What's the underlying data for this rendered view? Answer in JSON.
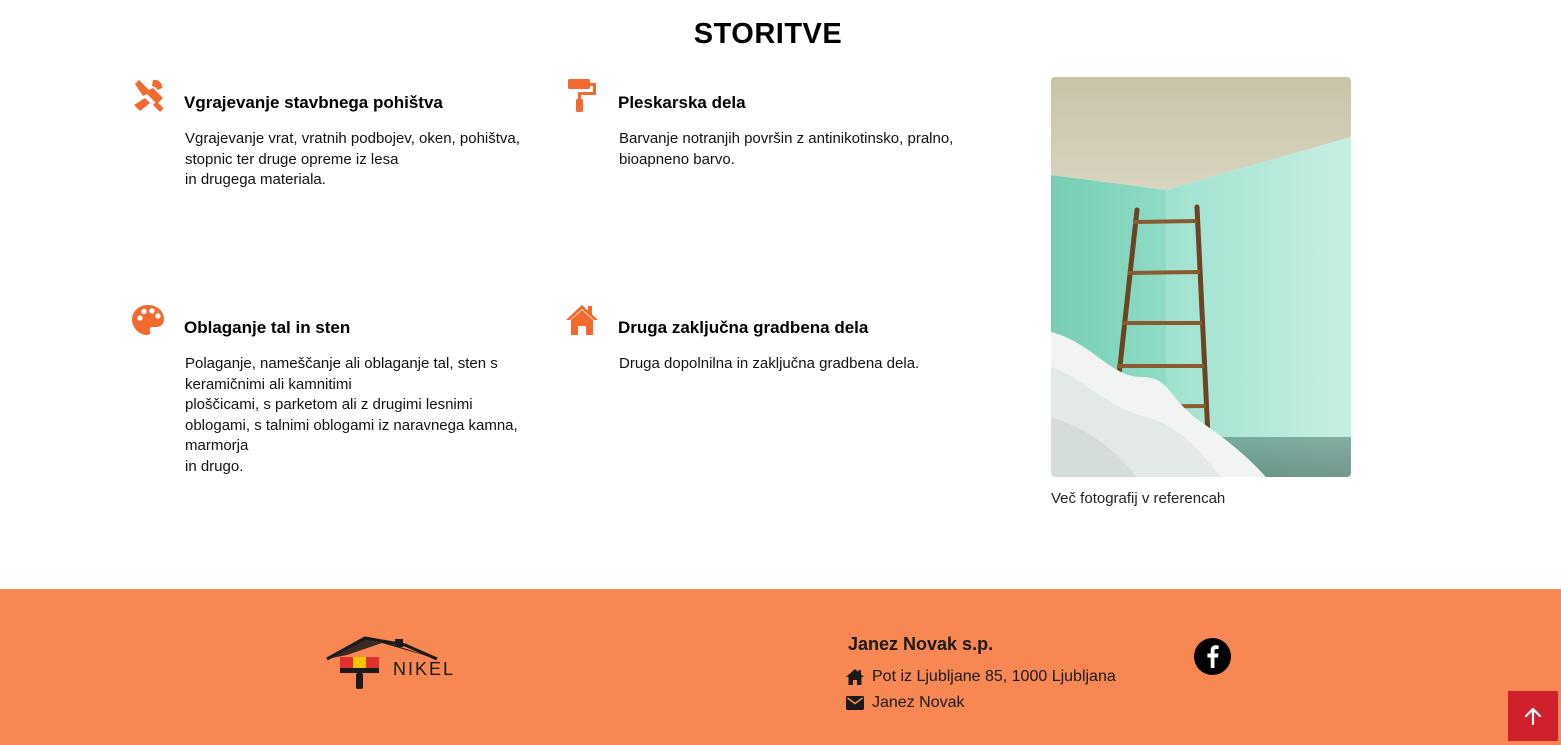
{
  "page": {
    "title": "STORITVE"
  },
  "services": [
    {
      "icon": "tools-icon",
      "title": "Vgrajevanje stavbnega pohištva",
      "lines": [
        "Vgrajevanje vrat, vratnih podbojev, oken, pohištva,",
        "stopnic ter druge opreme iz lesa",
        "in drugega materiala."
      ]
    },
    {
      "icon": "paint-roller-icon",
      "title": "Pleskarska dela",
      "lines": [
        "Barvanje notranjih površin z antinikotinsko, pralno,",
        "bioapneno barvo."
      ]
    },
    {
      "icon": "palette-icon",
      "title": "Oblaganje tal in sten",
      "lines": [
        "Polaganje, nameščanje ali oblaganje tal, sten s",
        "keramičnimi ali kamnitimi",
        "ploščicami, s parketom ali z drugimi lesnimi",
        "oblogami, s talnimi oblogami iz naravnega kamna,",
        "marmorja",
        "in drugo."
      ]
    },
    {
      "icon": "house-icon",
      "title": "Druga zaključna gradbena dela",
      "lines": [
        "Druga dopolnilna in zaključna gradbena dela."
      ]
    }
  ],
  "photo": {
    "caption": "Več fotografij v referencah"
  },
  "footer": {
    "logo_text": "NIKEL",
    "company": "Janez Novak s.p.",
    "address": "Pot iz Ljubljane 85, 1000 Ljubljana",
    "email": "Janez Novak",
    "social": "facebook-icon"
  },
  "colors": {
    "accent": "#f26a2e",
    "footer_bg": "#f78854",
    "to_top_bg": "#d0202c"
  }
}
